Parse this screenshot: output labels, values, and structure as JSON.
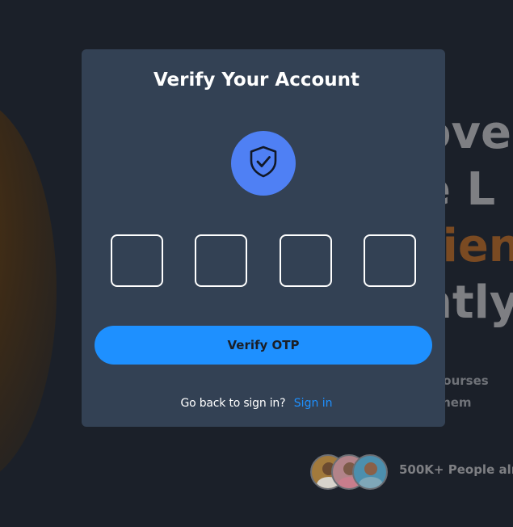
{
  "background": {
    "headline_lines": [
      "ove",
      "e L",
      "rien",
      "ntly"
    ],
    "subtext_lines": [
      "e courses",
      "n them"
    ],
    "people_text": "500K+ People alr"
  },
  "modal": {
    "title": "Verify Your Account",
    "shield_icon": "shield-check-icon",
    "otp": {
      "digit_count": 4,
      "values": [
        "",
        "",
        "",
        ""
      ]
    },
    "verify_button_label": "Verify OTP",
    "back_prompt": "Go back to sign in?",
    "signin_link_label": "Sign in"
  },
  "colors": {
    "page_background": "#1b2029",
    "card_background": "#334154",
    "shield_badge": "#4f80f4",
    "primary_button": "#1e90ff",
    "link": "#1e90ff",
    "headline_accent": "#7a4a22"
  }
}
